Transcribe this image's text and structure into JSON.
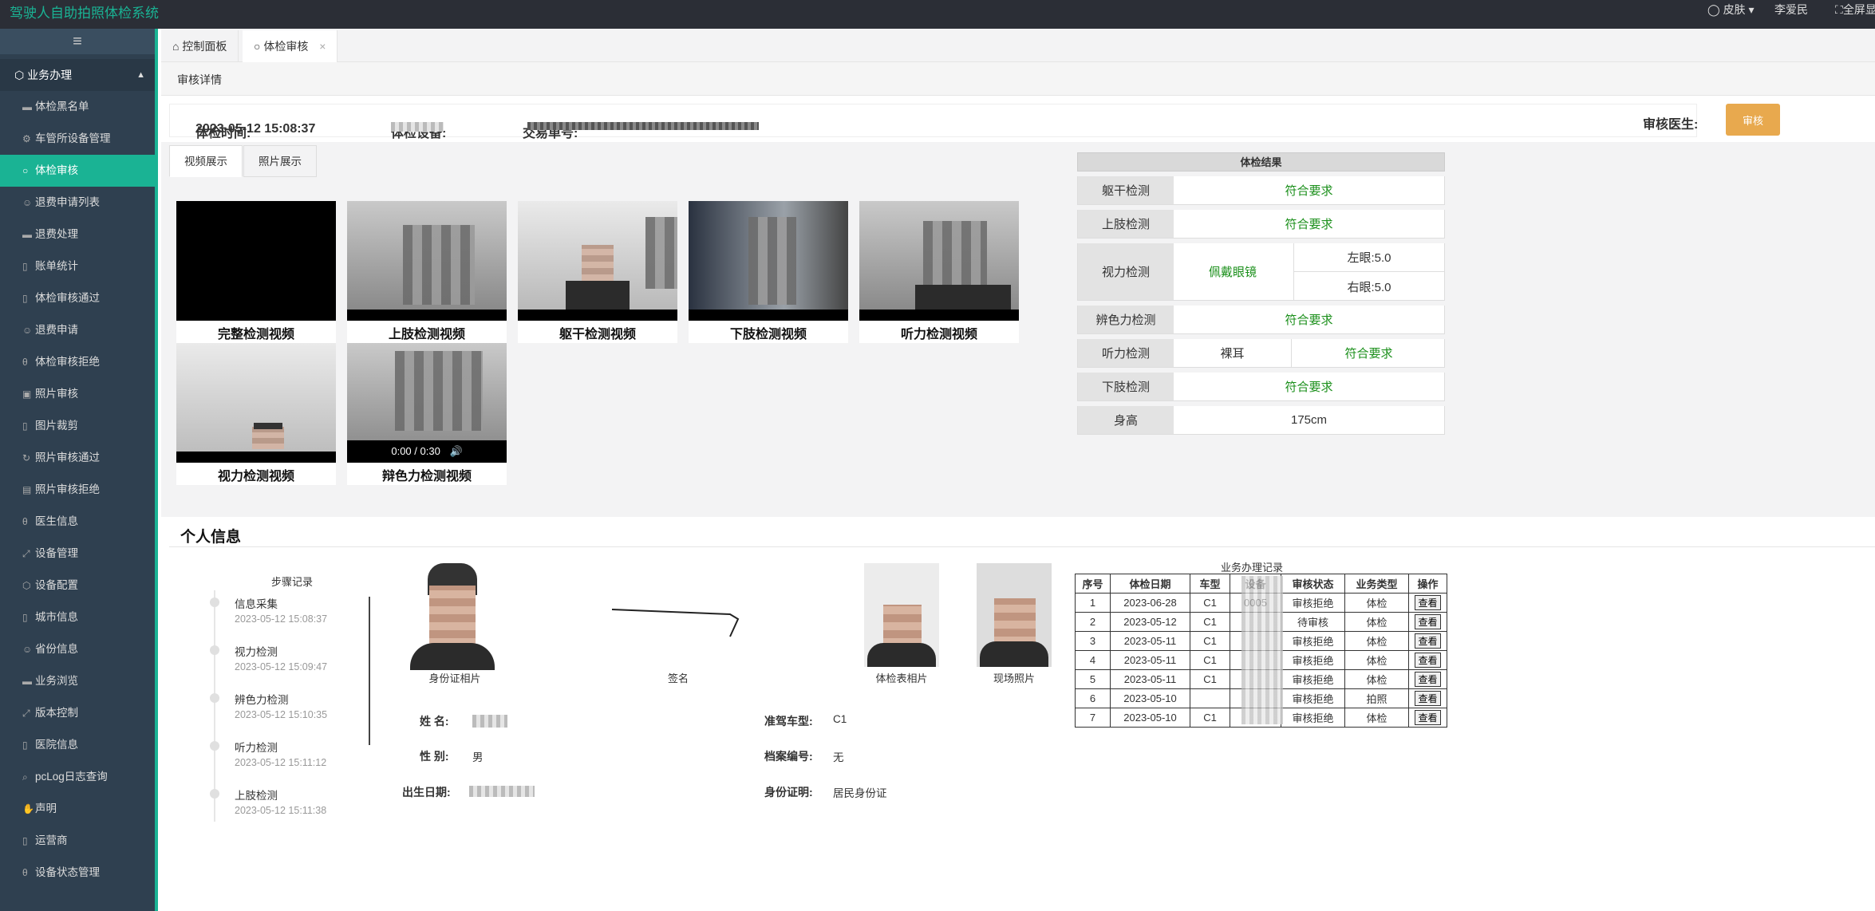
{
  "topbar": {
    "app_title": "驾驶人自助拍照体检系统",
    "skin": "皮肤",
    "user": "李爱民",
    "fullscreen": "全屏显示"
  },
  "sidebar": {
    "menu_icon": "hamburger-icon",
    "section": "业务办理",
    "items": [
      {
        "label": "体检黑名单",
        "icon": "folder-icon"
      },
      {
        "label": "车管所设备管理",
        "icon": "gear-icon"
      },
      {
        "label": "体检审核",
        "icon": "circle-icon",
        "active": true
      },
      {
        "label": "退费申请列表",
        "icon": "smile-icon"
      },
      {
        "label": "退费处理",
        "icon": "folder-icon"
      },
      {
        "label": "账单统计",
        "icon": "file-icon"
      },
      {
        "label": "体检审核通过",
        "icon": "file-icon"
      },
      {
        "label": "退费申请",
        "icon": "smile-icon"
      },
      {
        "label": "体检审核拒绝",
        "icon": "theta-icon"
      },
      {
        "label": "照片审核",
        "icon": "camera-icon"
      },
      {
        "label": "图片裁剪",
        "icon": "file-icon"
      },
      {
        "label": "照片审核通过",
        "icon": "refresh-icon"
      },
      {
        "label": "照片审核拒绝",
        "icon": "image-icon"
      },
      {
        "label": "医生信息",
        "icon": "theta-icon"
      },
      {
        "label": "设备管理",
        "icon": "expand-icon"
      },
      {
        "label": "设备配置",
        "icon": "cube-icon"
      },
      {
        "label": "城市信息",
        "icon": "file-icon"
      },
      {
        "label": "省份信息",
        "icon": "smile-icon"
      },
      {
        "label": "业务浏览",
        "icon": "folder-icon"
      },
      {
        "label": "版本控制",
        "icon": "expand-icon"
      },
      {
        "label": "医院信息",
        "icon": "file-icon"
      },
      {
        "label": "pcLog日志查询",
        "icon": "search-icon"
      },
      {
        "label": "声明",
        "icon": "hand-icon"
      },
      {
        "label": "运营商",
        "icon": "file-icon"
      },
      {
        "label": "设备状态管理",
        "icon": "theta-icon"
      }
    ]
  },
  "tabs": [
    {
      "label": "控制面板",
      "icon": "home-icon"
    },
    {
      "label": "体检审核",
      "icon": "circle-icon",
      "closable": true
    }
  ],
  "breadcrumb": "审核详情",
  "exam_info": {
    "time_label": "体检时间:",
    "time_value": "2023-05-12 15:08:37",
    "device_label": "体检设备:",
    "trade_label": "交易单号:",
    "doctor_label": "审核医生:",
    "audit_button": "审核"
  },
  "media_tabs": [
    "视频展示",
    "照片展示"
  ],
  "videos": [
    {
      "label": "完整检测视频"
    },
    {
      "label": "上肢检测视频"
    },
    {
      "label": "躯干检测视频"
    },
    {
      "label": "下肢检测视频"
    },
    {
      "label": "听力检测视频"
    },
    {
      "label": "视力检测视频"
    },
    {
      "label": "辩色力检测视频",
      "time": "0:00 / 0:30"
    }
  ],
  "results": {
    "title": "体检结果",
    "rows": [
      {
        "label": "躯干检测",
        "value": "符合要求"
      },
      {
        "label": "上肢检测",
        "value": "符合要求"
      },
      {
        "label": "视力检测",
        "value": "佩戴眼镜",
        "left": "左眼:5.0",
        "right": "右眼:5.0"
      },
      {
        "label": "辨色力检测",
        "value": "符合要求"
      },
      {
        "label": "听力检测",
        "sub": "裸耳",
        "value": "符合要求"
      },
      {
        "label": "下肢检测",
        "value": "符合要求"
      },
      {
        "label": "身高",
        "value": "175cm"
      }
    ],
    "colors": {
      "ok": "#1a8f1a",
      "warn": "#e03030"
    }
  },
  "personal": {
    "title": "个人信息",
    "steps_title": "步骤记录",
    "steps": [
      {
        "name": "信息采集",
        "time": "2023-05-12 15:08:37"
      },
      {
        "name": "视力检测",
        "time": "2023-05-12 15:09:47"
      },
      {
        "name": "辨色力检测",
        "time": "2023-05-12 15:10:35"
      },
      {
        "name": "听力检测",
        "time": "2023-05-12 15:11:12"
      },
      {
        "name": "上肢检测",
        "time": "2023-05-12 15:11:38"
      }
    ],
    "photos": {
      "id_photo": "身份证相片",
      "signature": "签名",
      "exam_photo": "体检表相片",
      "scene_photo": "现场照片"
    },
    "fields": {
      "name_label": "姓  名:",
      "gender_label": "性  别:",
      "gender": "男",
      "birth_label": "出生日期:",
      "vehicle_label": "准驾车型:",
      "vehicle": "C1",
      "archive_label": "档案编号:",
      "archive": "无",
      "id_label": "身份证明:",
      "id_value": "居民身份证"
    }
  },
  "records": {
    "title": "业务办理记录",
    "headers": [
      "序号",
      "体检日期",
      "车型",
      "设备",
      "审核状态",
      "业务类型",
      "操作"
    ],
    "rows": [
      [
        "1",
        "2023-06-28",
        "C1",
        "0005",
        "审核拒绝",
        "体检",
        "查看"
      ],
      [
        "2",
        "2023-05-12",
        "C1",
        "",
        "待审核",
        "体检",
        "查看"
      ],
      [
        "3",
        "2023-05-11",
        "C1",
        "",
        "审核拒绝",
        "体检",
        "查看"
      ],
      [
        "4",
        "2023-05-11",
        "C1",
        "",
        "审核拒绝",
        "体检",
        "查看"
      ],
      [
        "5",
        "2023-05-11",
        "C1",
        "",
        "审核拒绝",
        "体检",
        "查看"
      ],
      [
        "6",
        "2023-05-10",
        "",
        "",
        "审核拒绝",
        "拍照",
        "查看"
      ],
      [
        "7",
        "2023-05-10",
        "C1",
        "",
        "审核拒绝",
        "体检",
        "查看"
      ]
    ]
  }
}
